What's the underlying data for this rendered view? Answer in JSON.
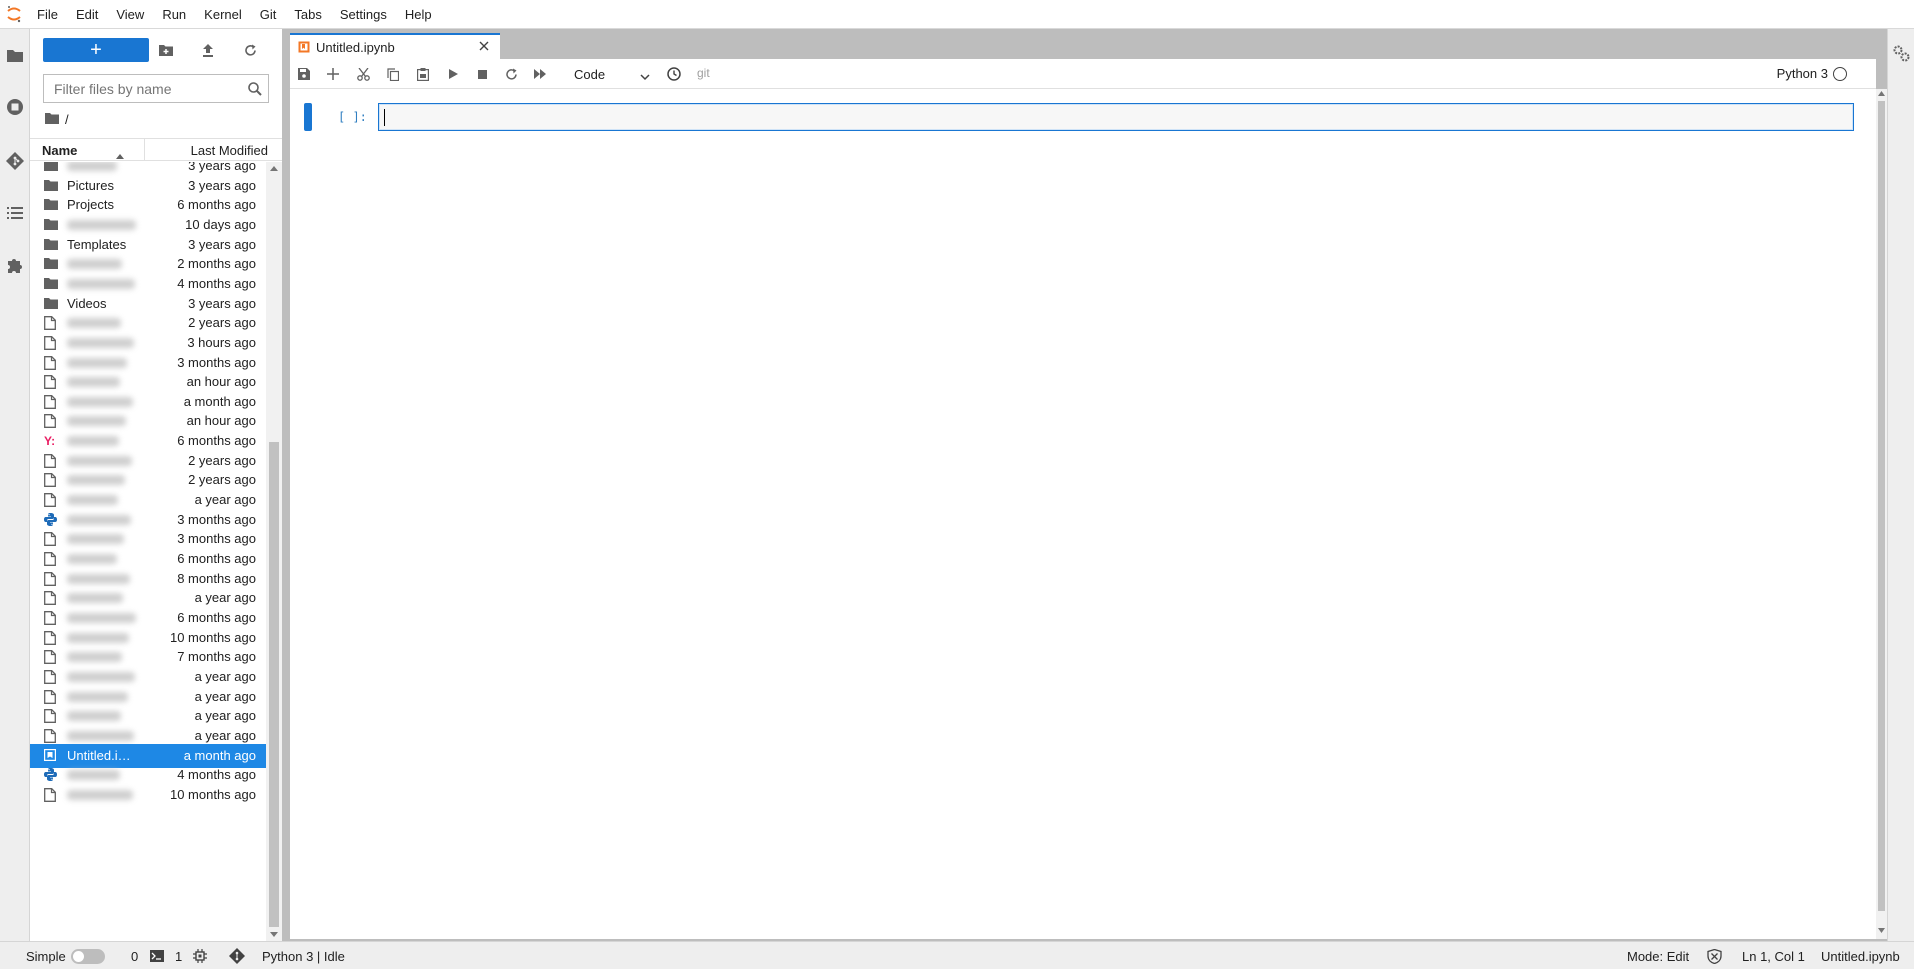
{
  "menu": [
    "File",
    "Edit",
    "View",
    "Run",
    "Kernel",
    "Git",
    "Tabs",
    "Settings",
    "Help"
  ],
  "filebrowser": {
    "new_label": "+",
    "filter_placeholder": "Filter files by name",
    "breadcrumb": "/",
    "col_name": "Name",
    "col_modified": "Last Modified",
    "rows": [
      {
        "name": "",
        "date": "3 years ago",
        "icon": "folder",
        "blurred": true
      },
      {
        "name": "Pictures",
        "date": "3 years ago",
        "icon": "folder",
        "blurred": false
      },
      {
        "name": "Projects",
        "date": "6 months ago",
        "icon": "folder",
        "blurred": false
      },
      {
        "name": "",
        "date": "10 days ago",
        "icon": "folder",
        "blurred": true
      },
      {
        "name": "Templates",
        "date": "3 years ago",
        "icon": "folder",
        "blurred": false
      },
      {
        "name": "",
        "date": "2 months ago",
        "icon": "folder",
        "blurred": true
      },
      {
        "name": "",
        "date": "4 months ago",
        "icon": "folder",
        "blurred": true
      },
      {
        "name": "Videos",
        "date": "3 years ago",
        "icon": "folder",
        "blurred": false
      },
      {
        "name": "",
        "date": "2 years ago",
        "icon": "file",
        "blurred": true
      },
      {
        "name": "",
        "date": "3 hours ago",
        "icon": "file",
        "blurred": true
      },
      {
        "name": "",
        "date": "3 months ago",
        "icon": "file",
        "blurred": true
      },
      {
        "name": "",
        "date": "an hour ago",
        "icon": "file",
        "blurred": true
      },
      {
        "name": "",
        "date": "a month ago",
        "icon": "file",
        "blurred": true
      },
      {
        "name": "",
        "date": "an hour ago",
        "icon": "file",
        "blurred": true
      },
      {
        "name": "",
        "date": "6 months ago",
        "icon": "yaml",
        "blurred": true
      },
      {
        "name": "",
        "date": "2 years ago",
        "icon": "file",
        "blurred": true
      },
      {
        "name": "",
        "date": "2 years ago",
        "icon": "file",
        "blurred": true
      },
      {
        "name": "",
        "date": "a year ago",
        "icon": "file",
        "blurred": true
      },
      {
        "name": "",
        "date": "3 months ago",
        "icon": "python",
        "blurred": true
      },
      {
        "name": "",
        "date": "3 months ago",
        "icon": "file",
        "blurred": true
      },
      {
        "name": "",
        "date": "6 months ago",
        "icon": "file",
        "blurred": true
      },
      {
        "name": "",
        "date": "8 months ago",
        "icon": "file",
        "blurred": true
      },
      {
        "name": "",
        "date": "a year ago",
        "icon": "file",
        "blurred": true
      },
      {
        "name": "",
        "date": "6 months ago",
        "icon": "file",
        "blurred": true
      },
      {
        "name": "",
        "date": "10 months ago",
        "icon": "file",
        "blurred": true
      },
      {
        "name": "",
        "date": "7 months ago",
        "icon": "file",
        "blurred": true
      },
      {
        "name": "",
        "date": "a year ago",
        "icon": "file",
        "blurred": true
      },
      {
        "name": "",
        "date": "a year ago",
        "icon": "file",
        "blurred": true
      },
      {
        "name": "",
        "date": "a year ago",
        "icon": "file",
        "blurred": true
      },
      {
        "name": "",
        "date": "a year ago",
        "icon": "file",
        "blurred": true
      },
      {
        "name": "Untitled.i…",
        "date": "a month ago",
        "icon": "notebook",
        "blurred": false,
        "selected": true
      },
      {
        "name": "",
        "date": "4 months ago",
        "icon": "python",
        "blurred": true
      },
      {
        "name": "",
        "date": "10 months ago",
        "icon": "file",
        "blurred": true
      }
    ]
  },
  "tab": {
    "label": "Untitled.ipynb"
  },
  "notebook": {
    "cell_type": "Code",
    "git_label": "git",
    "kernel_name": "Python 3",
    "cell_prompt": "[ ]:"
  },
  "statusbar": {
    "simple_label": "Simple",
    "terminals_count": "0",
    "kernels_count": "1",
    "kernel_status": "Python 3 | Idle",
    "mode": "Mode: Edit",
    "cursor_pos": "Ln 1, Col 1",
    "filename": "Untitled.ipynb"
  },
  "colors": {
    "accent": "#1976d2",
    "selected_row": "#1e88e5",
    "jupyter_orange": "#f37726",
    "yaml_red": "#e91e63",
    "python_blue": "#1e6bb8"
  }
}
